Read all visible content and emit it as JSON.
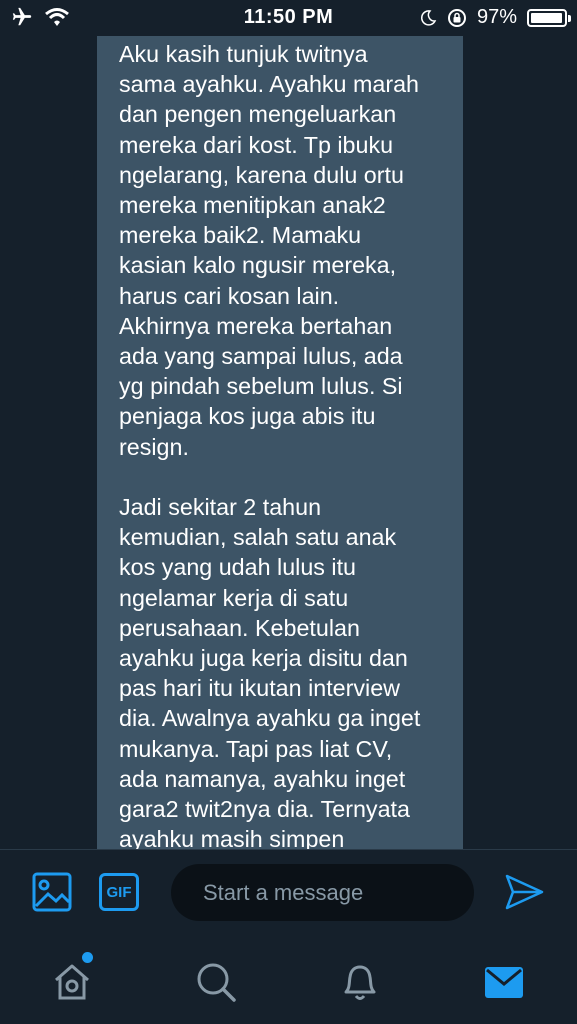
{
  "status_bar": {
    "time": "11:50 PM",
    "battery": "97%"
  },
  "message": {
    "text": "Aku kasih tunjuk twitnya\nsama ayahku. Ayahku marah\ndan pengen mengeluarkan\nmereka dari kost. Tp ibuku\nngelarang, karena dulu ortu\nmereka menitipkan anak2\nmereka baik2. Mamaku\nkasian kalo ngusir mereka,\nharus cari kosan lain.\nAkhirnya mereka bertahan\nada yang sampai lulus, ada\nyg pindah sebelum lulus. Si\npenjaga kos juga abis itu\nresign.\n\nJadi sekitar 2 tahun\nkemudian, salah satu anak\nkos yang udah lulus itu\nngelamar kerja di satu\nperusahaan. Kebetulan\nayahku juga kerja disitu dan\npas hari itu ikutan interview\ndia. Awalnya ayahku ga inget\nmukanya. Tapi pas liat CV,\nada namanya, ayahku inget\ngara2 twit2nya dia. Ternyata\nayahku masih simpen"
  },
  "composer": {
    "gif_label": "GIF",
    "placeholder": "Start a message"
  },
  "colors": {
    "background": "#15202b",
    "bubble": "#3d5466",
    "accent": "#1d9bf0",
    "input_bg": "#0b1117"
  },
  "icons": {
    "status": [
      "airplane-icon",
      "wifi-icon",
      "moon-icon",
      "rotation-lock-icon",
      "battery-icon"
    ],
    "composer": [
      "image-icon",
      "gif-icon",
      "send-icon"
    ],
    "tabs": [
      "home-icon",
      "search-icon",
      "notifications-icon",
      "messages-icon"
    ]
  }
}
